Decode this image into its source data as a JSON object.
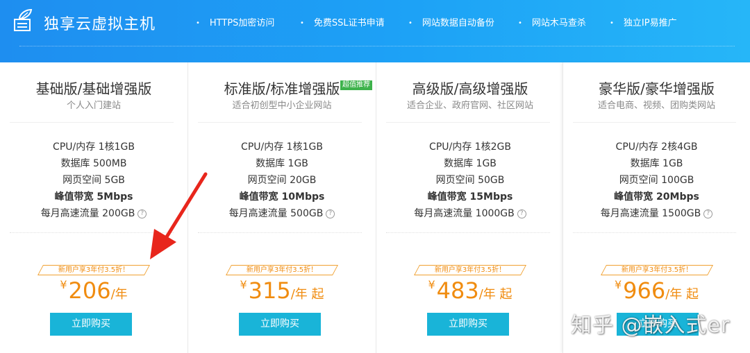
{
  "header": {
    "title": "独享云虚拟主机",
    "logo_icon": "document-pen-icon",
    "features": [
      "HTTPS加密访问",
      "免费SSL证书申请",
      "网站数据自动备份",
      "网站木马查杀",
      "独立IP易推广"
    ]
  },
  "help_glyph": "?",
  "plans": [
    {
      "name": "基础版/基础增强版",
      "subtitle": "个人入门建站",
      "tag": "",
      "specs": [
        "CPU/内存 1核1GB",
        "数据库 500MB",
        "网页空间 5GB",
        "峰值带宽 5Mbps",
        "每月高速流量 200GB"
      ],
      "promo": "新用户享3年付3.5折！",
      "currency": "¥",
      "price": "206",
      "unit": "/年",
      "buy_label": "立即购买"
    },
    {
      "name": "标准版/标准增强版",
      "subtitle": "适合初创型中小企业网站",
      "tag": "超值推荐",
      "specs": [
        "CPU/内存 1核1GB",
        "数据库 1GB",
        "网页空间 20GB",
        "峰值带宽 10Mbps",
        "每月高速流量 500GB"
      ],
      "promo": "新用户享3年付3.5折！",
      "currency": "¥",
      "price": "315",
      "unit": "/年 起",
      "buy_label": "立即购买"
    },
    {
      "name": "高级版/高级增强版",
      "subtitle": "适合企业、政府官网、社区网站",
      "tag": "",
      "specs": [
        "CPU/内存 1核2GB",
        "数据库 1GB",
        "网页空间 50GB",
        "峰值带宽 15Mbps",
        "每月高速流量 1000GB"
      ],
      "promo": "新用户享3年付3.5折！",
      "currency": "¥",
      "price": "483",
      "unit": "/年 起",
      "buy_label": "立即购买"
    },
    {
      "name": "豪华版/豪华增强版",
      "subtitle": "适合电商、视频、团购类网站",
      "tag": "",
      "specs": [
        "CPU/内存 2核4GB",
        "数据库 1GB",
        "网页空间 100GB",
        "峰值带宽 20Mbps",
        "每月高速流量 1500GB"
      ],
      "promo": "新用户享3年付3.5折！",
      "currency": "¥",
      "price": "966",
      "unit": "/年 起",
      "buy_label": "立即购买"
    }
  ],
  "watermark": "知乎 @嵌入式er",
  "colors": {
    "banner_start": "#1e8ef0",
    "banner_end": "#26b6f8",
    "price": "#f08c10",
    "button": "#19b4d8",
    "tag": "#3db24b",
    "arrow": "#e8261c"
  }
}
